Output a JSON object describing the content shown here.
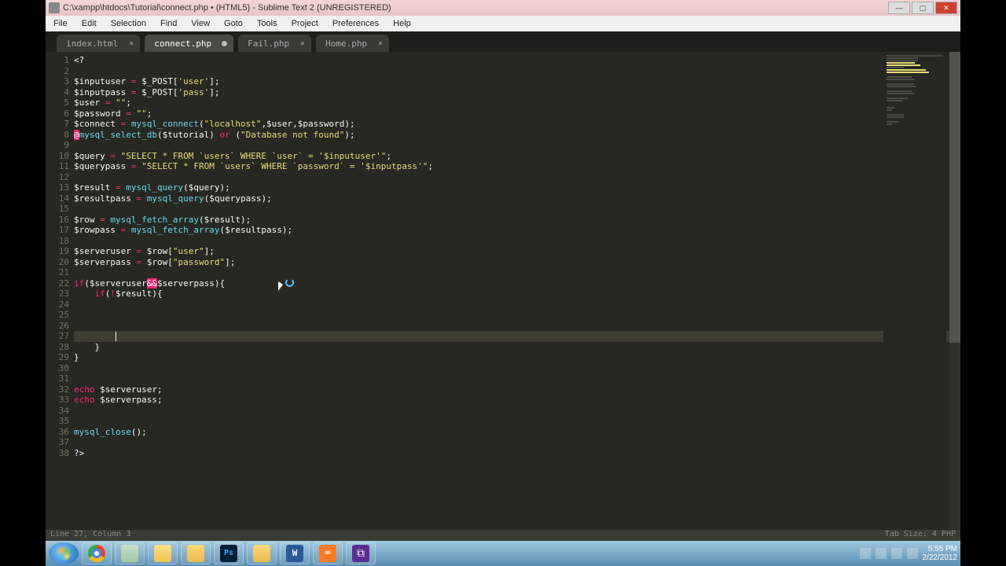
{
  "window": {
    "title": "C:\\xampp\\htdocs\\Tutorial\\connect.php • (HTML5) - Sublime Text 2 (UNREGISTERED)"
  },
  "menu": [
    "File",
    "Edit",
    "Selection",
    "Find",
    "View",
    "Goto",
    "Tools",
    "Project",
    "Preferences",
    "Help"
  ],
  "tabs": [
    {
      "label": "index.html",
      "dirty": false,
      "active": false
    },
    {
      "label": "connect.php",
      "dirty": true,
      "active": true
    },
    {
      "label": "Fail.php",
      "dirty": false,
      "active": false
    },
    {
      "label": "Home.php",
      "dirty": false,
      "active": false
    }
  ],
  "status": {
    "left": "Line 27, Column 3",
    "right": "Tab Size: 4   PHP"
  },
  "taskbar_apps": [
    "chrome",
    "pin",
    "explorer",
    "folder",
    "ps",
    "folder",
    "word",
    "xampp",
    "vs"
  ],
  "clock": {
    "time": "5:55 PM",
    "date": "2/22/2012"
  },
  "code": [
    {
      "n": 1,
      "t": [
        [
          "var",
          "<?"
        ]
      ]
    },
    {
      "n": 2,
      "t": []
    },
    {
      "n": 3,
      "t": [
        [
          "var",
          "$inputuser "
        ],
        [
          "op",
          "="
        ],
        [
          "var",
          " $_POST["
        ],
        [
          "str",
          "'user'"
        ],
        [
          "var",
          "];"
        ]
      ]
    },
    {
      "n": 4,
      "t": [
        [
          "var",
          "$inputpass "
        ],
        [
          "op",
          "="
        ],
        [
          "var",
          " $_POST["
        ],
        [
          "str",
          "'pass'"
        ],
        [
          "var",
          "];"
        ]
      ]
    },
    {
      "n": 5,
      "t": [
        [
          "var",
          "$user "
        ],
        [
          "op",
          "="
        ],
        [
          "var",
          " "
        ],
        [
          "str",
          "\"\""
        ],
        [
          "var",
          ";"
        ]
      ]
    },
    {
      "n": 6,
      "t": [
        [
          "var",
          "$password "
        ],
        [
          "op",
          "="
        ],
        [
          "var",
          " "
        ],
        [
          "str",
          "\"\""
        ],
        [
          "var",
          ";"
        ]
      ]
    },
    {
      "n": 7,
      "t": [
        [
          "var",
          "$connect "
        ],
        [
          "op",
          "="
        ],
        [
          "var",
          " "
        ],
        [
          "fn",
          "mysql_connect"
        ],
        [
          "var",
          "("
        ],
        [
          "str",
          "\"localhost\""
        ],
        [
          "var",
          ",$user,$password);"
        ]
      ]
    },
    {
      "n": 8,
      "t": [
        [
          "err",
          "@"
        ],
        [
          "fn",
          "mysql_select_db"
        ],
        [
          "var",
          "($tutorial) "
        ],
        [
          "kw",
          "or"
        ],
        [
          "var",
          " ("
        ],
        [
          "str",
          "\"Database not found\""
        ],
        [
          "var",
          ");"
        ]
      ]
    },
    {
      "n": 9,
      "t": []
    },
    {
      "n": 10,
      "t": [
        [
          "var",
          "$query "
        ],
        [
          "op",
          "="
        ],
        [
          "var",
          " "
        ],
        [
          "str",
          "\"SELECT * FROM `users` WHERE `user` = '$inputuser'\""
        ],
        [
          "var",
          ";"
        ]
      ]
    },
    {
      "n": 11,
      "t": [
        [
          "var",
          "$querypass "
        ],
        [
          "op",
          "="
        ],
        [
          "var",
          " "
        ],
        [
          "str",
          "\"SELECT * FROM `users` WHERE `password` = '$inputpass'\""
        ],
        [
          "var",
          ";"
        ]
      ]
    },
    {
      "n": 12,
      "t": []
    },
    {
      "n": 13,
      "t": [
        [
          "var",
          "$result "
        ],
        [
          "op",
          "="
        ],
        [
          "var",
          " "
        ],
        [
          "fn",
          "mysql_query"
        ],
        [
          "var",
          "($query);"
        ]
      ]
    },
    {
      "n": 14,
      "t": [
        [
          "var",
          "$resultpass "
        ],
        [
          "op",
          "="
        ],
        [
          "var",
          " "
        ],
        [
          "fn",
          "mysql_query"
        ],
        [
          "var",
          "($querypass);"
        ]
      ]
    },
    {
      "n": 15,
      "t": []
    },
    {
      "n": 16,
      "t": [
        [
          "var",
          "$row "
        ],
        [
          "op",
          "="
        ],
        [
          "var",
          " "
        ],
        [
          "fn",
          "mysql_fetch_array"
        ],
        [
          "var",
          "($result);"
        ]
      ]
    },
    {
      "n": 17,
      "t": [
        [
          "var",
          "$rowpass "
        ],
        [
          "op",
          "="
        ],
        [
          "var",
          " "
        ],
        [
          "fn",
          "mysql_fetch_array"
        ],
        [
          "var",
          "($resultpass);"
        ]
      ]
    },
    {
      "n": 18,
      "t": []
    },
    {
      "n": 19,
      "t": [
        [
          "var",
          "$serveruser "
        ],
        [
          "op",
          "="
        ],
        [
          "var",
          " $row["
        ],
        [
          "str",
          "\"user\""
        ],
        [
          "var",
          "];"
        ]
      ]
    },
    {
      "n": 20,
      "t": [
        [
          "var",
          "$serverpass "
        ],
        [
          "op",
          "="
        ],
        [
          "var",
          " $row["
        ],
        [
          "str",
          "\"password\""
        ],
        [
          "var",
          "];"
        ]
      ]
    },
    {
      "n": 21,
      "t": []
    },
    {
      "n": 22,
      "t": [
        [
          "cond",
          "if"
        ],
        [
          "var",
          "($serveruser"
        ],
        [
          "err",
          "&&"
        ],
        [
          "var",
          "$serverpass){"
        ]
      ]
    },
    {
      "n": 23,
      "t": [
        [
          "var",
          "    "
        ],
        [
          "cond",
          "if"
        ],
        [
          "var",
          "("
        ],
        [
          "op",
          "!"
        ],
        [
          "var",
          "$result){"
        ]
      ]
    },
    {
      "n": 24,
      "t": []
    },
    {
      "n": 25,
      "t": []
    },
    {
      "n": 26,
      "t": []
    },
    {
      "n": 27,
      "t": [
        [
          "var",
          "        "
        ]
      ],
      "hl": true,
      "caret": true
    },
    {
      "n": 28,
      "t": [
        [
          "var",
          "    }"
        ]
      ]
    },
    {
      "n": 29,
      "t": [
        [
          "var",
          "}"
        ]
      ]
    },
    {
      "n": 30,
      "t": []
    },
    {
      "n": 31,
      "t": []
    },
    {
      "n": 32,
      "t": [
        [
          "kw",
          "echo"
        ],
        [
          "var",
          " $serveruser;"
        ]
      ]
    },
    {
      "n": 33,
      "t": [
        [
          "kw",
          "echo"
        ],
        [
          "var",
          " $serverpass;"
        ]
      ]
    },
    {
      "n": 34,
      "t": []
    },
    {
      "n": 35,
      "t": []
    },
    {
      "n": 36,
      "t": [
        [
          "fn",
          "mysql_close"
        ],
        [
          "var",
          "();"
        ]
      ]
    },
    {
      "n": 37,
      "t": []
    },
    {
      "n": 38,
      "t": [
        [
          "var",
          "?>"
        ]
      ]
    }
  ]
}
